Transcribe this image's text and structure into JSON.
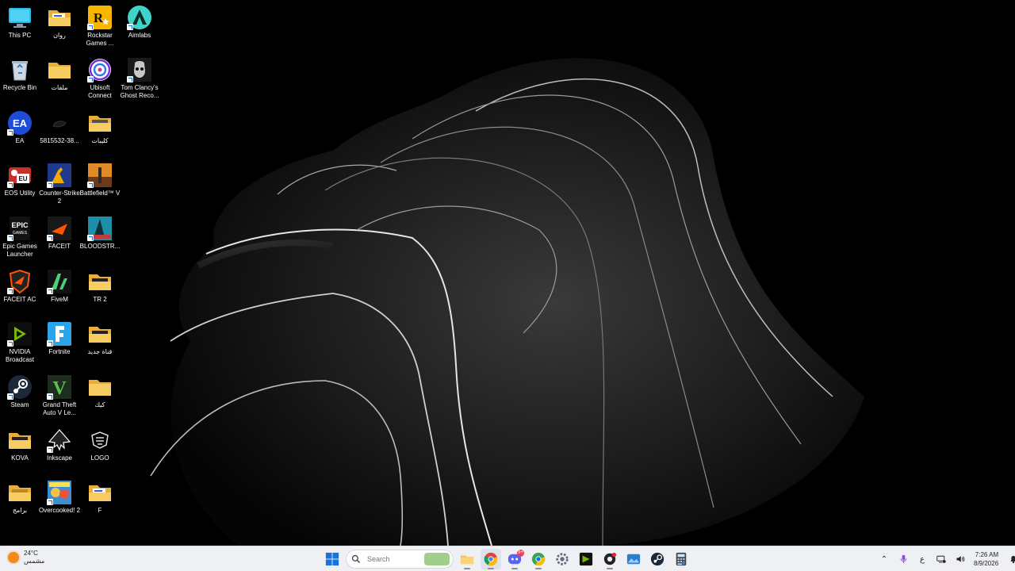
{
  "desktop": {
    "icons": [
      {
        "id": "this-pc",
        "label": "This PC",
        "kind": "monitor",
        "col": 0,
        "row": 0,
        "shortcut": false
      },
      {
        "id": "recycle-bin",
        "label": "Recycle Bin",
        "kind": "recycle",
        "col": 0,
        "row": 1,
        "shortcut": false
      },
      {
        "id": "ea",
        "label": "EA",
        "kind": "ea",
        "col": 0,
        "row": 2,
        "shortcut": true
      },
      {
        "id": "eos-utility",
        "label": "EOS Utility",
        "kind": "eos",
        "col": 0,
        "row": 3,
        "shortcut": true
      },
      {
        "id": "epic-games",
        "label": "Epic Games Launcher",
        "kind": "epic",
        "col": 0,
        "row": 4,
        "shortcut": true
      },
      {
        "id": "faceit-ac",
        "label": "FACEIT AC",
        "kind": "faceitac",
        "col": 0,
        "row": 5,
        "shortcut": true
      },
      {
        "id": "nvidia-broadcast",
        "label": "NVIDIA Broadcast",
        "kind": "nvidia",
        "col": 0,
        "row": 6,
        "shortcut": true
      },
      {
        "id": "steam",
        "label": "Steam",
        "kind": "steam",
        "col": 0,
        "row": 7,
        "shortcut": true
      },
      {
        "id": "kova",
        "label": "KOVA",
        "kind": "folder-dark",
        "col": 0,
        "row": 8,
        "shortcut": false
      },
      {
        "id": "baramej",
        "label": "برامج",
        "kind": "folder-gold",
        "col": 0,
        "row": 9,
        "shortcut": false
      },
      {
        "id": "rawan",
        "label": "روان",
        "kind": "folder-doc",
        "col": 1,
        "row": 0,
        "shortcut": false
      },
      {
        "id": "malafat",
        "label": "ملفات",
        "kind": "folder",
        "col": 1,
        "row": 1,
        "shortcut": false
      },
      {
        "id": "img-5815532",
        "label": "5815532-38...",
        "kind": "image-dark",
        "col": 1,
        "row": 2,
        "shortcut": false
      },
      {
        "id": "counter-strike",
        "label": "Counter-Strike 2",
        "kind": "cs2",
        "col": 1,
        "row": 3,
        "shortcut": true
      },
      {
        "id": "faceit",
        "label": "FACEIT",
        "kind": "faceit",
        "col": 1,
        "row": 4,
        "shortcut": true
      },
      {
        "id": "fivem",
        "label": "FiveM",
        "kind": "fivem",
        "col": 1,
        "row": 5,
        "shortcut": true
      },
      {
        "id": "fortnite",
        "label": "Fortnite",
        "kind": "fortnite",
        "col": 1,
        "row": 6,
        "shortcut": true
      },
      {
        "id": "gta-v",
        "label": "Grand Theft Auto V Le...",
        "kind": "gta",
        "col": 1,
        "row": 7,
        "shortcut": true
      },
      {
        "id": "inkscape",
        "label": "Inkscape",
        "kind": "inkscape",
        "col": 1,
        "row": 8,
        "shortcut": true
      },
      {
        "id": "overcooked",
        "label": "Overcooked! 2",
        "kind": "overcooked",
        "col": 1,
        "row": 9,
        "shortcut": true
      },
      {
        "id": "rockstar",
        "label": "Rockstar Games ...",
        "kind": "rockstar",
        "col": 2,
        "row": 0,
        "shortcut": true
      },
      {
        "id": "ubisoft",
        "label": "Ubisoft Connect",
        "kind": "ubisoft",
        "col": 2,
        "row": 1,
        "shortcut": true
      },
      {
        "id": "kolibat",
        "label": "كليبات",
        "kind": "folder-film",
        "col": 2,
        "row": 2,
        "shortcut": false
      },
      {
        "id": "battlefield",
        "label": "Battlefield™ V",
        "kind": "battlefield",
        "col": 2,
        "row": 3,
        "shortcut": true
      },
      {
        "id": "bloodstrike",
        "label": "BLOODSTR...",
        "kind": "bloodstrike",
        "col": 2,
        "row": 4,
        "shortcut": true
      },
      {
        "id": "tr2",
        "label": "TR 2",
        "kind": "folder-dark",
        "col": 2,
        "row": 5,
        "shortcut": false
      },
      {
        "id": "qanat-jadid",
        "label": "قناة جديد",
        "kind": "folder-dark",
        "col": 2,
        "row": 6,
        "shortcut": false
      },
      {
        "id": "kik",
        "label": "كيك",
        "kind": "folder",
        "col": 2,
        "row": 7,
        "shortcut": false
      },
      {
        "id": "logo",
        "label": "LOGO",
        "kind": "logo",
        "col": 2,
        "row": 8,
        "shortcut": false
      },
      {
        "id": "f-folder",
        "label": "F",
        "kind": "folder-doc",
        "col": 2,
        "row": 9,
        "shortcut": false
      },
      {
        "id": "aimlabs",
        "label": "Aimlabs",
        "kind": "aimlabs",
        "col": 3,
        "row": 0,
        "shortcut": true
      },
      {
        "id": "ghost-recon",
        "label": "Tom Clancy's Ghost Reco...",
        "kind": "ghost",
        "col": 3,
        "row": 1,
        "shortcut": true
      }
    ]
  },
  "taskbar": {
    "weather": {
      "temp": "24°C",
      "condition": "مشمس"
    },
    "search": {
      "placeholder": "Search"
    },
    "apps": [
      {
        "name": "start",
        "icon": "windows-icon",
        "active": false
      },
      {
        "name": "search",
        "icon": "search-icon",
        "active": false
      },
      {
        "name": "file-explorer",
        "icon": "folder-icon",
        "active": true
      },
      {
        "name": "chrome",
        "icon": "chrome-icon",
        "active": true
      },
      {
        "name": "discord",
        "icon": "discord-icon",
        "active": true,
        "badge": "9+"
      },
      {
        "name": "chrome-profile",
        "icon": "chrome-alt-icon",
        "active": true
      },
      {
        "name": "settings",
        "icon": "gear-icon",
        "active": false
      },
      {
        "name": "nvidia",
        "icon": "nvidia-icon",
        "active": false
      },
      {
        "name": "obs",
        "icon": "record-icon",
        "active": true
      },
      {
        "name": "photos",
        "icon": "photos-icon",
        "active": false
      },
      {
        "name": "steam",
        "icon": "steam-icon",
        "active": false
      },
      {
        "name": "calculator",
        "icon": "calculator-icon",
        "active": false
      }
    ],
    "tray": {
      "language": "ع",
      "time": "7:26 AM",
      "date": "8/9/2026"
    }
  },
  "colors": {
    "accent": "#0067c0",
    "folder": "#f5c65a",
    "taskbar": "#eef0f4"
  }
}
